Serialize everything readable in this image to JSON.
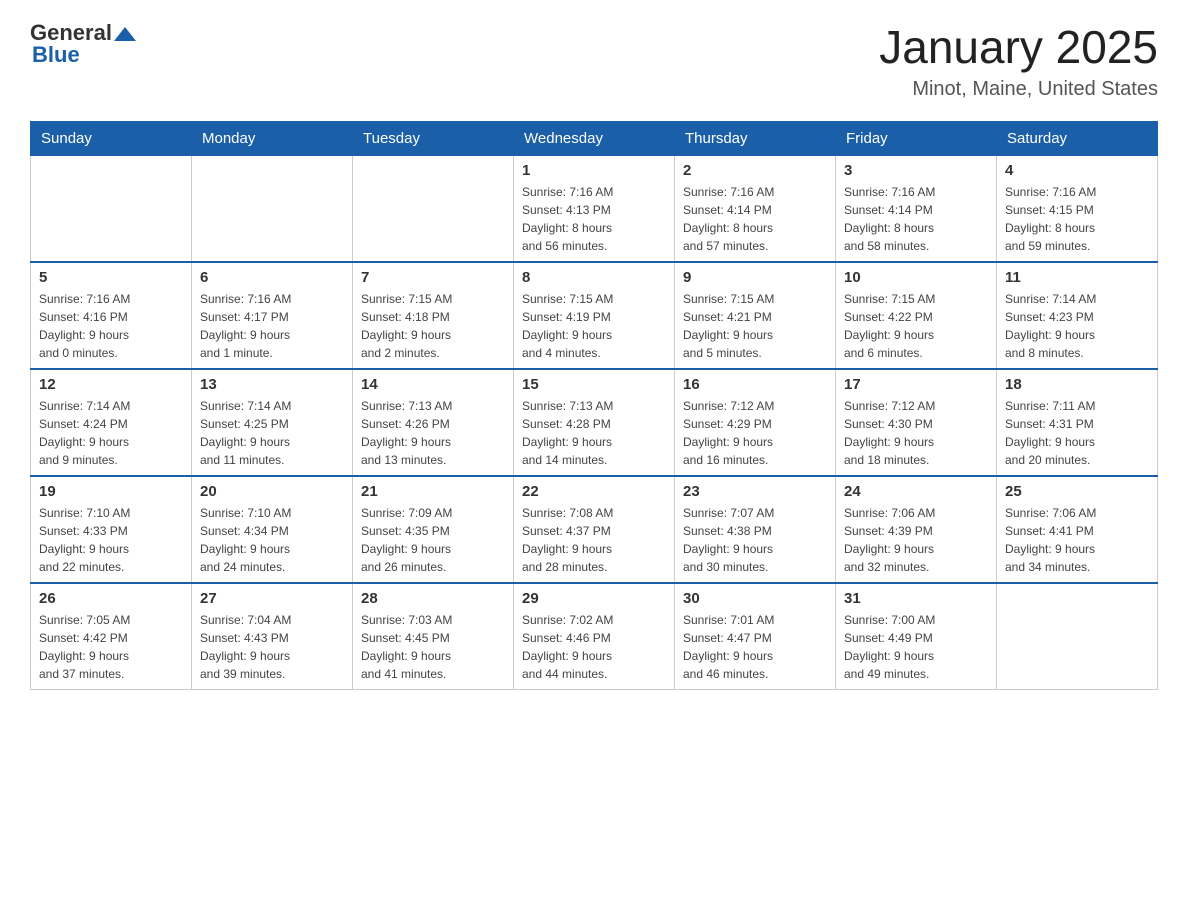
{
  "header": {
    "logo_general": "General",
    "logo_blue": "Blue",
    "title": "January 2025",
    "subtitle": "Minot, Maine, United States"
  },
  "days_of_week": [
    "Sunday",
    "Monday",
    "Tuesday",
    "Wednesday",
    "Thursday",
    "Friday",
    "Saturday"
  ],
  "weeks": [
    [
      {
        "day": "",
        "info": ""
      },
      {
        "day": "",
        "info": ""
      },
      {
        "day": "",
        "info": ""
      },
      {
        "day": "1",
        "info": "Sunrise: 7:16 AM\nSunset: 4:13 PM\nDaylight: 8 hours\nand 56 minutes."
      },
      {
        "day": "2",
        "info": "Sunrise: 7:16 AM\nSunset: 4:14 PM\nDaylight: 8 hours\nand 57 minutes."
      },
      {
        "day": "3",
        "info": "Sunrise: 7:16 AM\nSunset: 4:14 PM\nDaylight: 8 hours\nand 58 minutes."
      },
      {
        "day": "4",
        "info": "Sunrise: 7:16 AM\nSunset: 4:15 PM\nDaylight: 8 hours\nand 59 minutes."
      }
    ],
    [
      {
        "day": "5",
        "info": "Sunrise: 7:16 AM\nSunset: 4:16 PM\nDaylight: 9 hours\nand 0 minutes."
      },
      {
        "day": "6",
        "info": "Sunrise: 7:16 AM\nSunset: 4:17 PM\nDaylight: 9 hours\nand 1 minute."
      },
      {
        "day": "7",
        "info": "Sunrise: 7:15 AM\nSunset: 4:18 PM\nDaylight: 9 hours\nand 2 minutes."
      },
      {
        "day": "8",
        "info": "Sunrise: 7:15 AM\nSunset: 4:19 PM\nDaylight: 9 hours\nand 4 minutes."
      },
      {
        "day": "9",
        "info": "Sunrise: 7:15 AM\nSunset: 4:21 PM\nDaylight: 9 hours\nand 5 minutes."
      },
      {
        "day": "10",
        "info": "Sunrise: 7:15 AM\nSunset: 4:22 PM\nDaylight: 9 hours\nand 6 minutes."
      },
      {
        "day": "11",
        "info": "Sunrise: 7:14 AM\nSunset: 4:23 PM\nDaylight: 9 hours\nand 8 minutes."
      }
    ],
    [
      {
        "day": "12",
        "info": "Sunrise: 7:14 AM\nSunset: 4:24 PM\nDaylight: 9 hours\nand 9 minutes."
      },
      {
        "day": "13",
        "info": "Sunrise: 7:14 AM\nSunset: 4:25 PM\nDaylight: 9 hours\nand 11 minutes."
      },
      {
        "day": "14",
        "info": "Sunrise: 7:13 AM\nSunset: 4:26 PM\nDaylight: 9 hours\nand 13 minutes."
      },
      {
        "day": "15",
        "info": "Sunrise: 7:13 AM\nSunset: 4:28 PM\nDaylight: 9 hours\nand 14 minutes."
      },
      {
        "day": "16",
        "info": "Sunrise: 7:12 AM\nSunset: 4:29 PM\nDaylight: 9 hours\nand 16 minutes."
      },
      {
        "day": "17",
        "info": "Sunrise: 7:12 AM\nSunset: 4:30 PM\nDaylight: 9 hours\nand 18 minutes."
      },
      {
        "day": "18",
        "info": "Sunrise: 7:11 AM\nSunset: 4:31 PM\nDaylight: 9 hours\nand 20 minutes."
      }
    ],
    [
      {
        "day": "19",
        "info": "Sunrise: 7:10 AM\nSunset: 4:33 PM\nDaylight: 9 hours\nand 22 minutes."
      },
      {
        "day": "20",
        "info": "Sunrise: 7:10 AM\nSunset: 4:34 PM\nDaylight: 9 hours\nand 24 minutes."
      },
      {
        "day": "21",
        "info": "Sunrise: 7:09 AM\nSunset: 4:35 PM\nDaylight: 9 hours\nand 26 minutes."
      },
      {
        "day": "22",
        "info": "Sunrise: 7:08 AM\nSunset: 4:37 PM\nDaylight: 9 hours\nand 28 minutes."
      },
      {
        "day": "23",
        "info": "Sunrise: 7:07 AM\nSunset: 4:38 PM\nDaylight: 9 hours\nand 30 minutes."
      },
      {
        "day": "24",
        "info": "Sunrise: 7:06 AM\nSunset: 4:39 PM\nDaylight: 9 hours\nand 32 minutes."
      },
      {
        "day": "25",
        "info": "Sunrise: 7:06 AM\nSunset: 4:41 PM\nDaylight: 9 hours\nand 34 minutes."
      }
    ],
    [
      {
        "day": "26",
        "info": "Sunrise: 7:05 AM\nSunset: 4:42 PM\nDaylight: 9 hours\nand 37 minutes."
      },
      {
        "day": "27",
        "info": "Sunrise: 7:04 AM\nSunset: 4:43 PM\nDaylight: 9 hours\nand 39 minutes."
      },
      {
        "day": "28",
        "info": "Sunrise: 7:03 AM\nSunset: 4:45 PM\nDaylight: 9 hours\nand 41 minutes."
      },
      {
        "day": "29",
        "info": "Sunrise: 7:02 AM\nSunset: 4:46 PM\nDaylight: 9 hours\nand 44 minutes."
      },
      {
        "day": "30",
        "info": "Sunrise: 7:01 AM\nSunset: 4:47 PM\nDaylight: 9 hours\nand 46 minutes."
      },
      {
        "day": "31",
        "info": "Sunrise: 7:00 AM\nSunset: 4:49 PM\nDaylight: 9 hours\nand 49 minutes."
      },
      {
        "day": "",
        "info": ""
      }
    ]
  ]
}
